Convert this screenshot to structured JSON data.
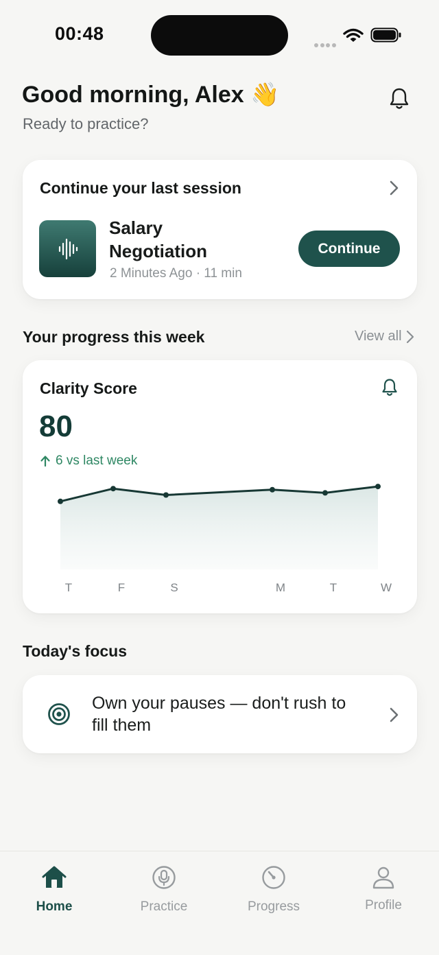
{
  "status_bar": {
    "time": "00:48"
  },
  "header": {
    "greeting": "Good morning, Alex 👋",
    "subtitle": "Ready to practice?",
    "bell_icon": "bell-icon"
  },
  "session_card": {
    "title": "Continue your last session",
    "session_name": "Salary Negotiation",
    "meta": "2 Minutes Ago · 11 min",
    "button_label": "Continue",
    "thumbnail_icon": "waveform-icon"
  },
  "progress": {
    "heading": "Your progress this week",
    "view_all": "View all",
    "card": {
      "title": "Clarity Score",
      "score": "80",
      "delta": "6 vs last week"
    }
  },
  "chart_data": {
    "type": "area",
    "categories": [
      "T",
      "F",
      "S",
      "M",
      "T",
      "W"
    ],
    "values": [
      72,
      78,
      75,
      77.5,
      76,
      79
    ],
    "ylim": [
      40,
      90
    ],
    "grid": false,
    "colors": {
      "line": "#173834",
      "fill": "#dfe9e7"
    }
  },
  "focus": {
    "heading": "Today's focus",
    "text": "Own your pauses — don't rush to fill them",
    "icon": "target-icon"
  },
  "tabbar": {
    "tabs": [
      {
        "label": "Home",
        "icon": "home-icon",
        "active": true
      },
      {
        "label": "Practice",
        "icon": "microphone-icon",
        "active": false
      },
      {
        "label": "Progress",
        "icon": "gauge-icon",
        "active": false
      },
      {
        "label": "Profile",
        "icon": "person-icon",
        "active": false
      }
    ]
  },
  "colors": {
    "accent": "#1f524c",
    "positive": "#2e8763",
    "background": "#f6f6f4"
  }
}
